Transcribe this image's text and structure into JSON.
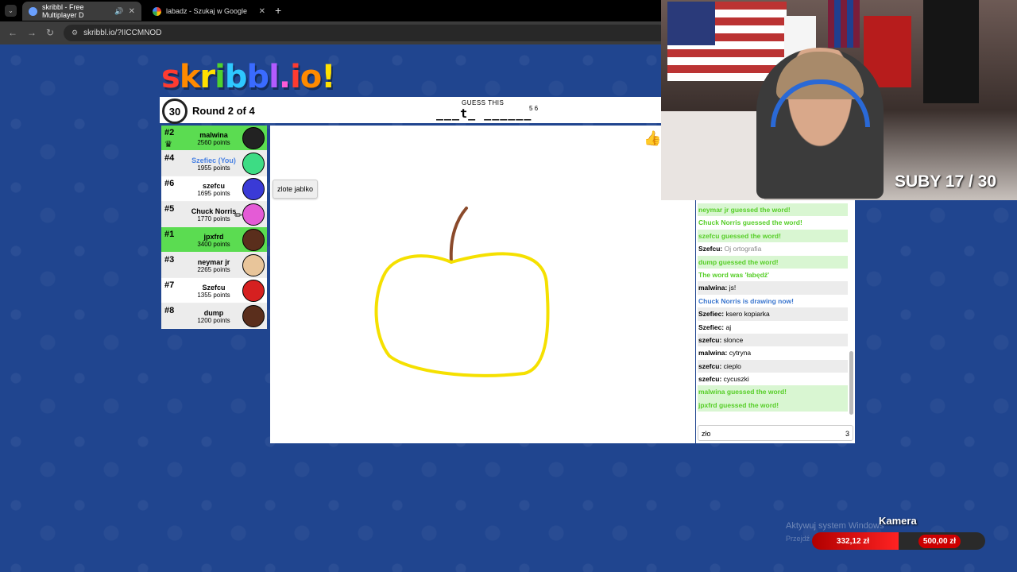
{
  "browser": {
    "tabs": [
      {
        "title": "skribbl - Free Multiplayer D",
        "active": true
      },
      {
        "title": "labadz - Szukaj w Google",
        "active": false
      }
    ],
    "url": "skribbl.io/?IICCMNOD"
  },
  "logo": "skribbl.io",
  "game": {
    "timer": "30",
    "round": "Round 2 of 4",
    "guess_label": "GUESS THIS",
    "word_hint": "___t_ ______",
    "word_lengths": "5 6"
  },
  "players": [
    {
      "rank": "#2",
      "name": "malwina",
      "points": "2560 points",
      "guessed": true,
      "crown": true,
      "avatar_color": "#222222"
    },
    {
      "rank": "#4",
      "name": "Szefiec (You)",
      "points": "1955 points",
      "you": true,
      "avatar_color": "#3ddc84"
    },
    {
      "rank": "#6",
      "name": "szefcu",
      "points": "1695 points",
      "avatar_color": "#3a3ad6"
    },
    {
      "rank": "#5",
      "name": "Chuck Norris",
      "points": "1770 points",
      "drawing": true,
      "avatar_color": "#e45bd6"
    },
    {
      "rank": "#1",
      "name": "jpxfrd",
      "points": "3400 points",
      "guessed": true,
      "avatar_color": "#5a2e1c"
    },
    {
      "rank": "#3",
      "name": "neymar jr",
      "points": "2265 points",
      "avatar_color": "#e8c59a"
    },
    {
      "rank": "#7",
      "name": "Szefcu",
      "points": "1355 points",
      "avatar_color": "#d62020"
    },
    {
      "rank": "#8",
      "name": "dump",
      "points": "1200 points",
      "avatar_color": "#5a2e1c"
    }
  ],
  "bubble_text": "zlote jablko",
  "chat": [
    {
      "type": "ok",
      "text": "neymar jr guessed the word!"
    },
    {
      "type": "ok",
      "text": "Chuck Norris guessed the word!"
    },
    {
      "type": "ok",
      "text": "szefcu guessed the word!"
    },
    {
      "type": "msg",
      "author": "Szefcu:",
      "text": "Oj ortografia",
      "grey": true
    },
    {
      "type": "ok",
      "text": "dump guessed the word!"
    },
    {
      "type": "ok",
      "text": "The word was 'łabędź'"
    },
    {
      "type": "msg",
      "author": "malwina:",
      "text": "js!"
    },
    {
      "type": "blue",
      "text": "Chuck Norris is drawing now!"
    },
    {
      "type": "msg",
      "author": "Szefiec:",
      "text": "ksero kopiarka"
    },
    {
      "type": "msg",
      "author": "Szefiec:",
      "text": "aj"
    },
    {
      "type": "msg",
      "author": "szefcu:",
      "text": "slonce"
    },
    {
      "type": "msg",
      "author": "malwina:",
      "text": "cytryna"
    },
    {
      "type": "msg",
      "author": "szefcu:",
      "text": "cieplo"
    },
    {
      "type": "msg",
      "author": "szefcu:",
      "text": "cycuszki"
    },
    {
      "type": "ok",
      "text": "malwina guessed the word!"
    },
    {
      "type": "ok",
      "text": "jpxfrd guessed the word!"
    }
  ],
  "chat_input": {
    "value": "zło",
    "count": "3"
  },
  "stream": {
    "counter": "SUBY 17 / 30",
    "camera_label": "Kamera",
    "donation_current": "332,12 zł",
    "donation_goal": "500,00 zł",
    "watermark_line1": "Aktywuj system Windows",
    "watermark_line2": "Przejdź ... Windows."
  }
}
